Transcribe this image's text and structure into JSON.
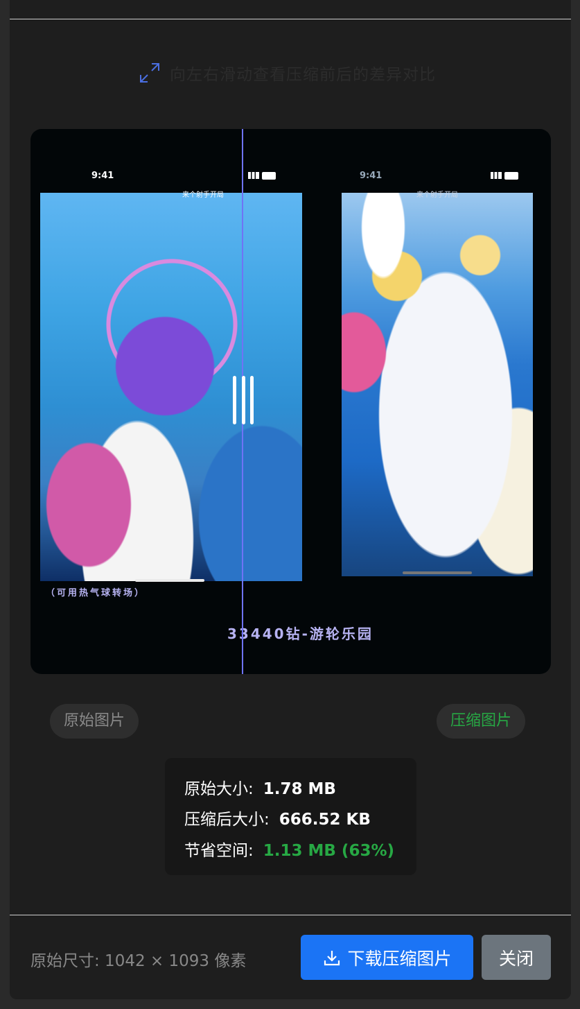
{
  "hint": {
    "text": "向左右滑动查看压缩前后的差异对比"
  },
  "preview": {
    "left_phone": {
      "time": "9:41",
      "title": "来个射手开局"
    },
    "right_phone": {
      "time": "9:41",
      "title": "来个射手开局"
    },
    "label_small": "（可用热气球转场）",
    "label_big": "33440钻-游轮乐园"
  },
  "labels": {
    "original": "原始图片",
    "compressed": "压缩图片"
  },
  "stats": {
    "original_label": "原始大小:",
    "original_value": "1.78 MB",
    "compressed_label": "压缩后大小:",
    "compressed_value": "666.52 KB",
    "saved_label": "节省空间:",
    "saved_value": "1.13 MB (63%)"
  },
  "footer": {
    "dimensions": "原始尺寸: 1042 × 1093 像素",
    "download_label": "下载压缩图片",
    "close_label": "关闭"
  },
  "colors": {
    "accent": "#1b74f5",
    "success": "#27a844",
    "divider": "#6f73f5"
  }
}
